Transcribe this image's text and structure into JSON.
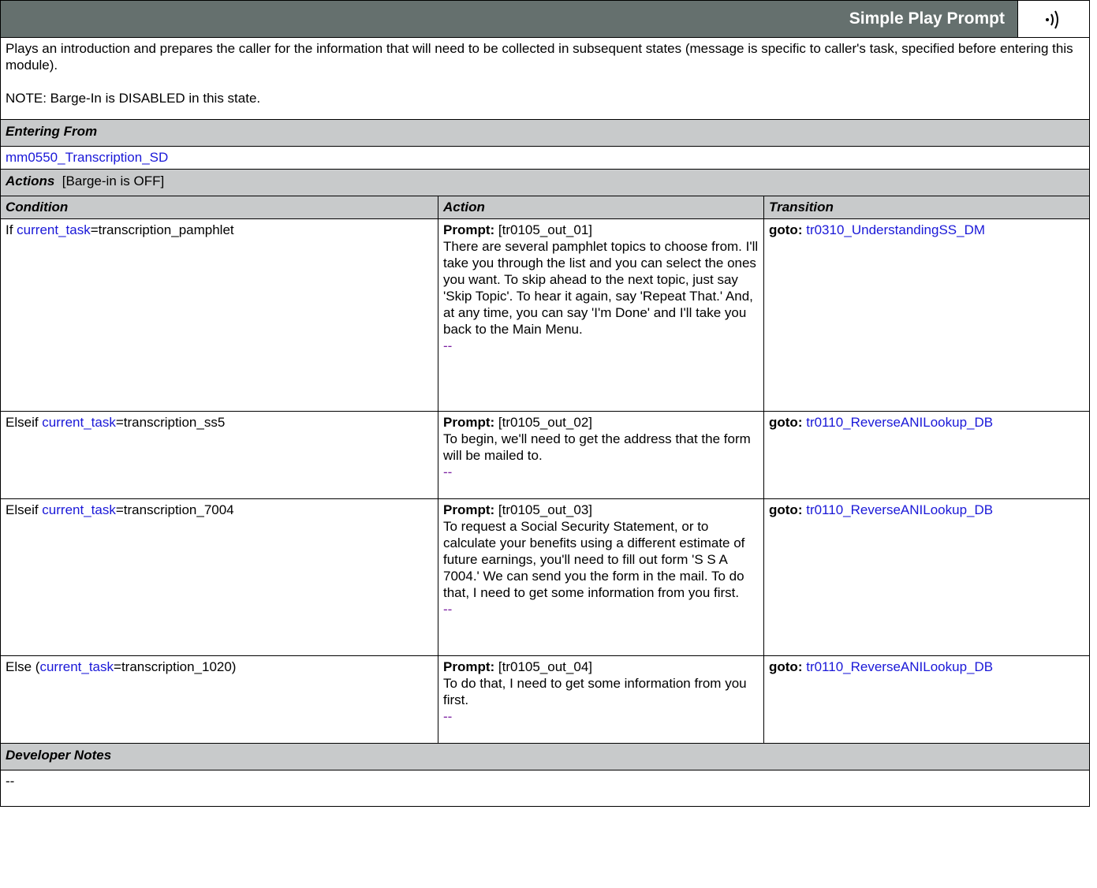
{
  "header": {
    "title": "Simple Play Prompt",
    "icon": "speaker-sound-icon"
  },
  "description": {
    "line1": "Plays an introduction and prepares the caller for the information that will need to be collected in subsequent states (message is specific to caller's task, specified before entering this module).",
    "note": "NOTE: Barge-In is DISABLED in this state."
  },
  "entering_from": {
    "label": "Entering From",
    "link": "mm0550_Transcription_SD"
  },
  "actions": {
    "label": "Actions",
    "barge_note": "[Barge-in is OFF]",
    "columns": [
      "Condition",
      "Action",
      "Transition"
    ],
    "rows": [
      {
        "cond_prefix": "If ",
        "cond_link": "current_task",
        "cond_suffix": "=transcription_pamphlet",
        "prompt_label": "Prompt:",
        "prompt_id": " [tr0105_out_01]",
        "prompt_text": "There are several pamphlet topics to choose from. I'll take you through the list and you can select the ones you want. To skip ahead to the next topic, just say 'Skip Topic'.  To hear it again, say 'Repeat That.'  And, at any time, you can say 'I'm Done' and I'll take you back to the Main Menu.",
        "dash": "--",
        "goto_label": "goto:",
        "goto_link": "tr0310_UnderstandingSS_DM"
      },
      {
        "cond_prefix": "Elseif ",
        "cond_link": "current_task",
        "cond_suffix": "=transcription_ss5",
        "prompt_label": "Prompt:",
        "prompt_id": " [tr0105_out_02]",
        "prompt_text": "To begin, we'll need to get the address that the form will be mailed to.",
        "dash": "--",
        "goto_label": "goto:",
        "goto_link": "tr0110_ReverseANILookup_DB"
      },
      {
        "cond_prefix": "Elseif ",
        "cond_link": "current_task",
        "cond_suffix": "=transcription_7004",
        "prompt_label": "Prompt:",
        "prompt_id": " [tr0105_out_03]",
        "prompt_text": "To request a Social Security Statement, or to calculate your benefits using a different estimate of future earnings, you'll need to fill out form 'S S A 7004.'  We can send you the form in the mail.  To do that, I need to get some information from you first.",
        "dash": "--",
        "goto_label": "goto:",
        "goto_link": "tr0110_ReverseANILookup_DB"
      },
      {
        "cond_prefix": "Else (",
        "cond_link": "current_task",
        "cond_suffix": "=transcription_1020)",
        "prompt_label": "Prompt:",
        "prompt_id": " [tr0105_out_04]",
        "prompt_text": "To do that, I need to get some information from you first.",
        "dash": "--",
        "goto_label": "goto:",
        "goto_link": "tr0110_ReverseANILookup_DB"
      }
    ]
  },
  "developer_notes": {
    "label": "Developer Notes",
    "text": "--"
  }
}
